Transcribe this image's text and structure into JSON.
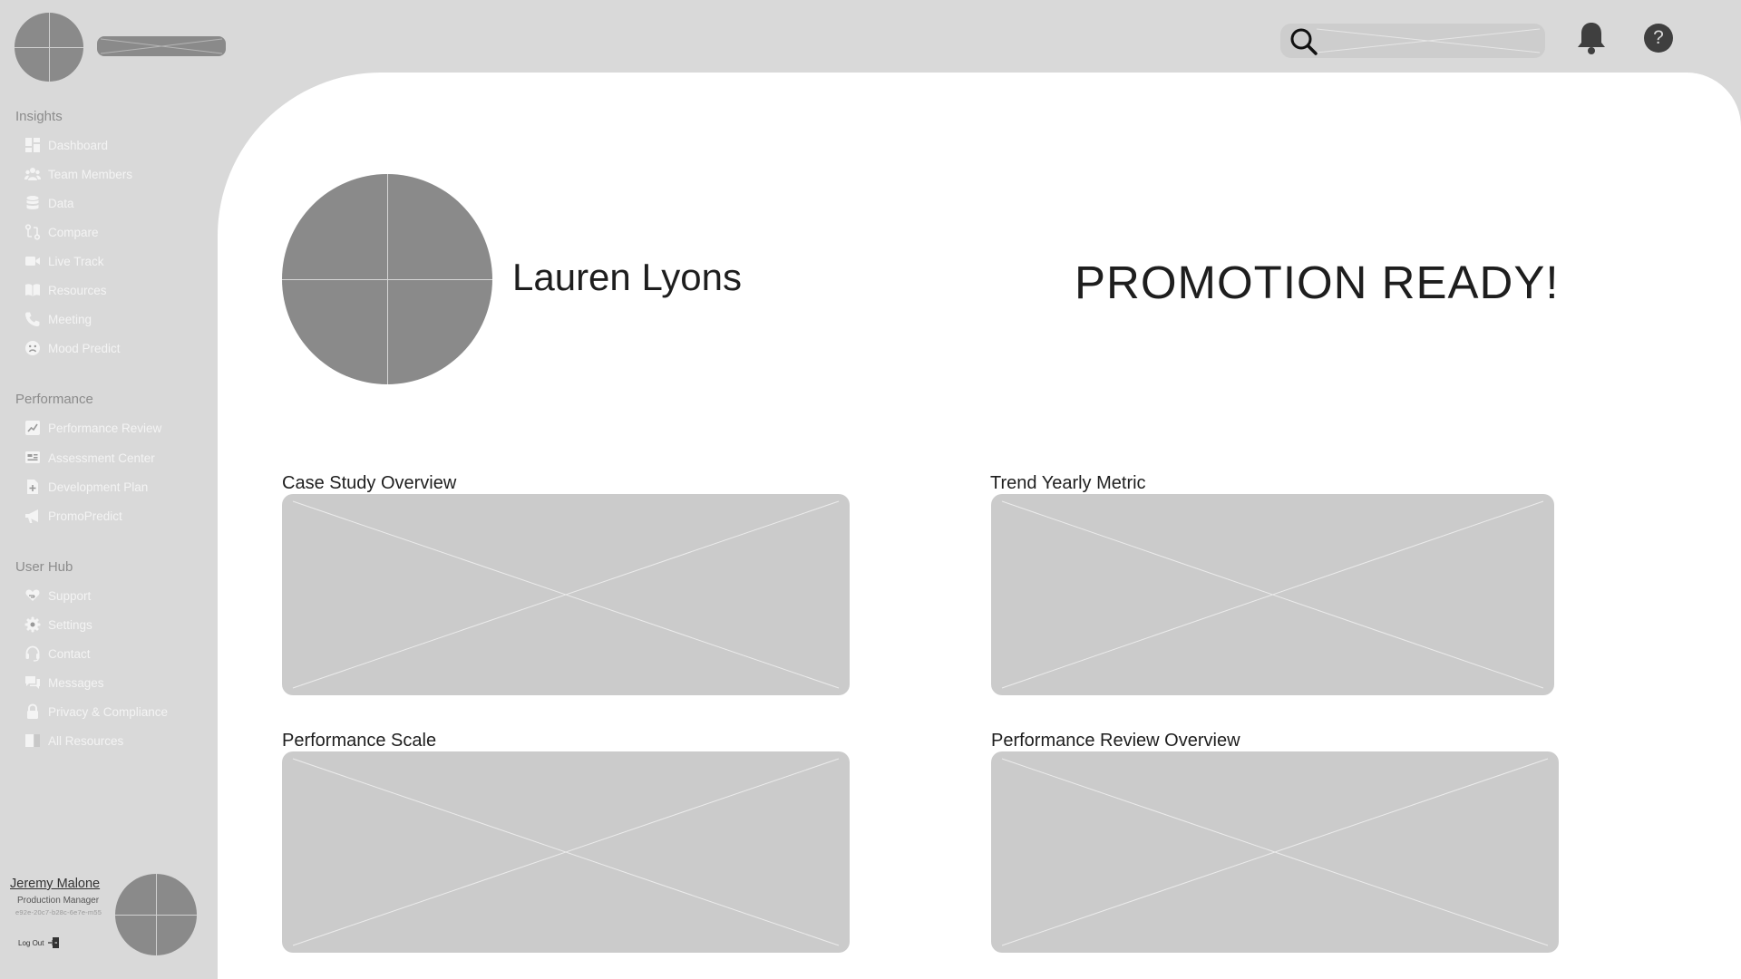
{
  "header": {
    "logo_icon": "logo-placeholder-icon",
    "search_icon": "search-icon",
    "bell_icon": "bell-icon",
    "help_label": "?"
  },
  "sidebar": {
    "sections": [
      {
        "title": "Insights",
        "items": [
          {
            "label": "Dashboard",
            "icon": "dashboard-icon"
          },
          {
            "label": "Team Members",
            "icon": "team-icon"
          },
          {
            "label": "Data",
            "icon": "database-icon"
          },
          {
            "label": "Compare",
            "icon": "compare-icon"
          },
          {
            "label": "Live Track",
            "icon": "video-icon"
          },
          {
            "label": "Resources",
            "icon": "book-icon"
          },
          {
            "label": "Meeting",
            "icon": "phone-icon"
          },
          {
            "label": "Mood Predict",
            "icon": "mood-icon"
          }
        ]
      },
      {
        "title": "Performance",
        "items": [
          {
            "label": "Performance Review",
            "icon": "chart-icon"
          },
          {
            "label": "Assessment Center",
            "icon": "assessment-icon"
          },
          {
            "label": "Development Plan",
            "icon": "document-plus-icon"
          },
          {
            "label": "PromoPredict",
            "icon": "megaphone-icon"
          }
        ]
      },
      {
        "title": "User Hub",
        "items": [
          {
            "label": "Support",
            "icon": "heart-hand-icon"
          },
          {
            "label": "Settings",
            "icon": "gear-icon"
          },
          {
            "label": "Contact",
            "icon": "headset-icon"
          },
          {
            "label": "Messages",
            "icon": "chat-icon"
          },
          {
            "label": "Privacy & Compliance",
            "icon": "lock-icon"
          },
          {
            "label": "All Resources",
            "icon": "folder-icon"
          }
        ]
      }
    ]
  },
  "user": {
    "name": "Jeremy Malone",
    "role": "Production Manager",
    "id": "e92e-20c7-b28c-6e7e-m55",
    "logout_label": "Log Out"
  },
  "profile": {
    "name": "Lauren Lyons",
    "status": "PROMOTION READY!"
  },
  "cards": [
    {
      "title": "Case Study Overview"
    },
    {
      "title": "Trend Yearly Metric"
    },
    {
      "title": "Performance Scale"
    },
    {
      "title": "Performance Review Overview"
    }
  ],
  "colors": {
    "background": "#d9d9d9",
    "content": "#ffffff",
    "placeholder": "#8a8a8a",
    "card": "#cbcbcb",
    "sidebar_text": "#f4f4f4"
  }
}
